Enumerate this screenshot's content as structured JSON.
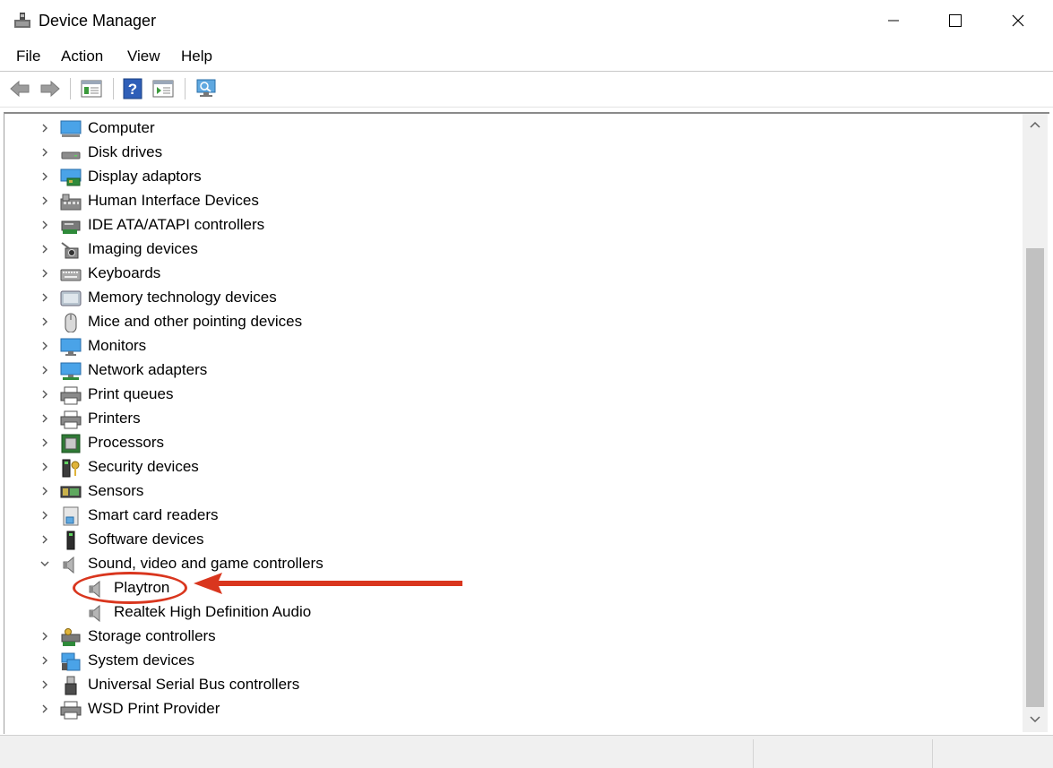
{
  "window": {
    "title": "Device Manager",
    "controls": {
      "minimize": "—",
      "maximize": "☐",
      "close": "✕"
    }
  },
  "menu": [
    "File",
    "Action",
    "View",
    "Help"
  ],
  "toolbar": {
    "buttons": [
      "back-icon",
      "forward-icon",
      "properties-icon",
      "help-icon",
      "update-driver-icon",
      "scan-hardware-icon"
    ]
  },
  "tree": {
    "categories": [
      {
        "label": "Computer",
        "icon": "computer-icon",
        "expanded": false
      },
      {
        "label": "Disk drives",
        "icon": "disk-drive-icon",
        "expanded": false
      },
      {
        "label": "Display adaptors",
        "icon": "display-adapter-icon",
        "expanded": false
      },
      {
        "label": "Human Interface Devices",
        "icon": "hid-icon",
        "expanded": false
      },
      {
        "label": "IDE ATA/ATAPI controllers",
        "icon": "ide-controller-icon",
        "expanded": false
      },
      {
        "label": "Imaging devices",
        "icon": "camera-icon",
        "expanded": false
      },
      {
        "label": "Keyboards",
        "icon": "keyboard-icon",
        "expanded": false
      },
      {
        "label": "Memory technology devices",
        "icon": "memory-icon",
        "expanded": false
      },
      {
        "label": "Mice and other pointing devices",
        "icon": "mouse-icon",
        "expanded": false
      },
      {
        "label": "Monitors",
        "icon": "monitor-icon",
        "expanded": false
      },
      {
        "label": "Network adapters",
        "icon": "network-adapter-icon",
        "expanded": false
      },
      {
        "label": "Print queues",
        "icon": "printer-icon",
        "expanded": false
      },
      {
        "label": "Printers",
        "icon": "printer-icon",
        "expanded": false
      },
      {
        "label": "Processors",
        "icon": "processor-icon",
        "expanded": false
      },
      {
        "label": "Security devices",
        "icon": "security-key-icon",
        "expanded": false
      },
      {
        "label": "Sensors",
        "icon": "sensor-icon",
        "expanded": false
      },
      {
        "label": "Smart card readers",
        "icon": "smart-card-icon",
        "expanded": false
      },
      {
        "label": "Software devices",
        "icon": "software-device-icon",
        "expanded": false
      },
      {
        "label": "Sound, video and game controllers",
        "icon": "speaker-icon",
        "expanded": true,
        "children": [
          {
            "label": "Playtron",
            "icon": "speaker-icon",
            "highlighted": true
          },
          {
            "label": "Realtek High Definition Audio",
            "icon": "speaker-icon"
          }
        ]
      },
      {
        "label": "Storage controllers",
        "icon": "storage-controller-icon",
        "expanded": false
      },
      {
        "label": "System devices",
        "icon": "system-device-icon",
        "expanded": false
      },
      {
        "label": "Universal Serial Bus controllers",
        "icon": "usb-icon",
        "expanded": false
      },
      {
        "label": "WSD Print Provider",
        "icon": "printer-icon",
        "expanded": false
      }
    ]
  },
  "annotation": {
    "color": "#d9361e",
    "target": "Playtron"
  }
}
